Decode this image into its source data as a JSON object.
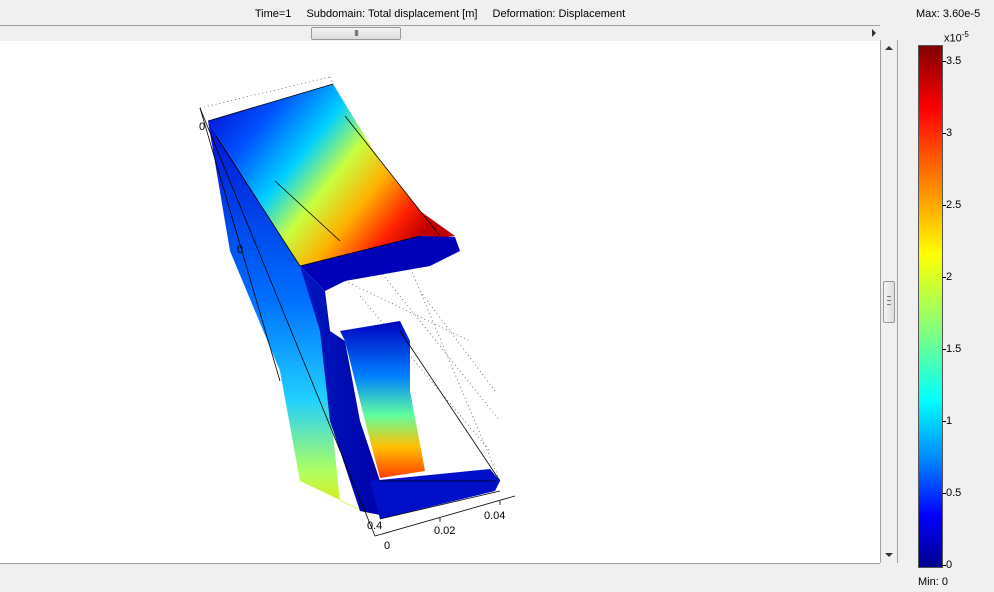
{
  "header": {
    "time": "Time=1",
    "subdomain": "Subdomain: Total displacement [m]",
    "deformation": "Deformation: Displacement"
  },
  "hscroll": {
    "thumb_grip": "III"
  },
  "colorbar": {
    "max_label": "Max: 3.60e-5",
    "min_label": "Min: 0",
    "scale_base": "x10",
    "scale_exp": "-5",
    "ticks": [
      "3.5",
      "3",
      "2.5",
      "2",
      "1.5",
      "1",
      "0.5",
      "0"
    ]
  },
  "axes": {
    "x_ticks": [
      "0",
      "0.02",
      "0.04"
    ],
    "z_tick": "0.4",
    "y_tick_top": "0",
    "y_tick_mid": "0"
  }
}
